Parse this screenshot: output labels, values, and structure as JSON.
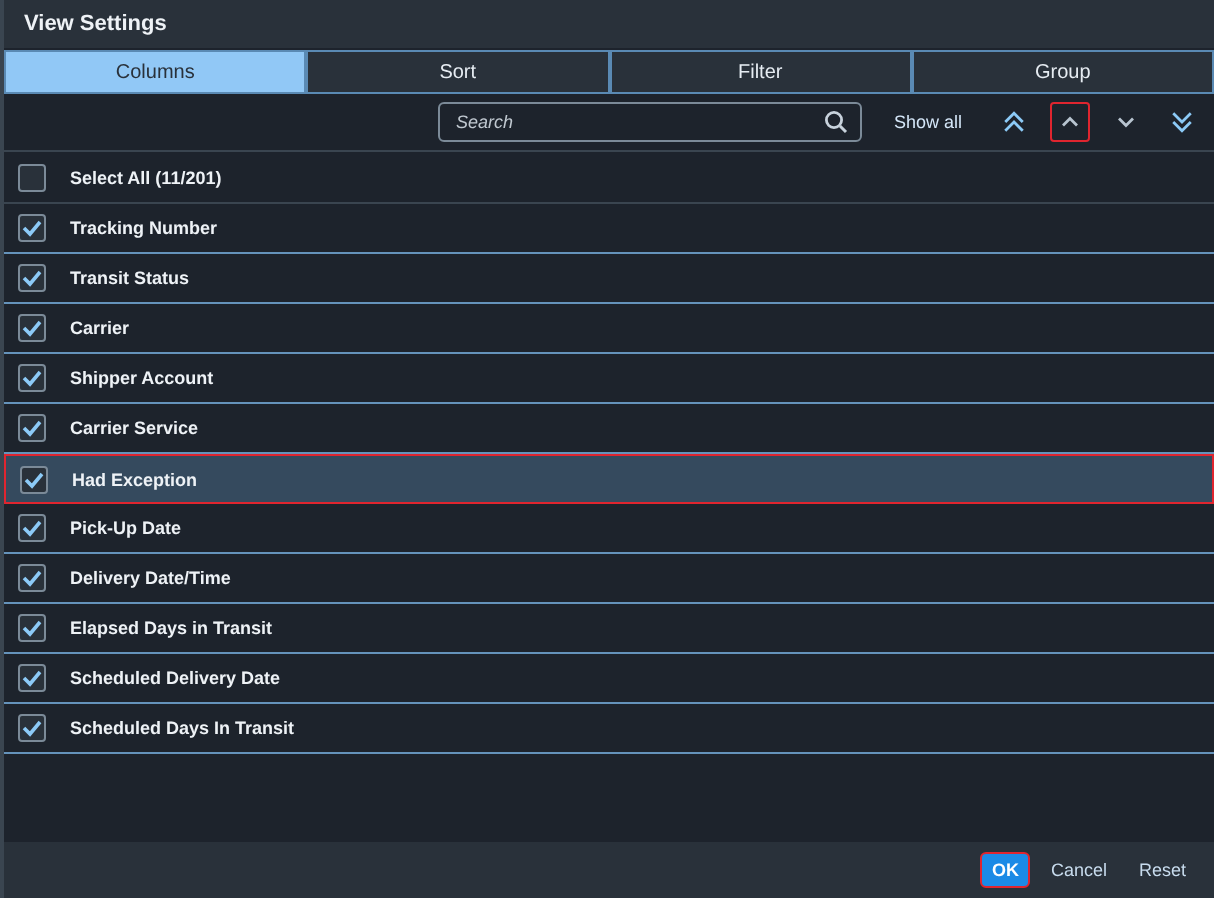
{
  "window": {
    "title": "View Settings"
  },
  "tabs": [
    {
      "label": "Columns",
      "selected": true
    },
    {
      "label": "Sort",
      "selected": false
    },
    {
      "label": "Filter",
      "selected": false
    },
    {
      "label": "Group",
      "selected": false
    }
  ],
  "toolbar": {
    "search": {
      "placeholder": "Search"
    },
    "show_all": "Show all",
    "move_buttons": [
      {
        "kind": "top",
        "highlighted": false
      },
      {
        "kind": "up",
        "highlighted": true
      },
      {
        "kind": "down",
        "highlighted": false
      },
      {
        "kind": "bottom",
        "highlighted": false
      }
    ]
  },
  "select_all": {
    "label": "Select All (11/201)",
    "checked": false
  },
  "columns": [
    {
      "label": "Tracking Number",
      "checked": true,
      "selected": false
    },
    {
      "label": "Transit Status",
      "checked": true,
      "selected": false
    },
    {
      "label": "Carrier",
      "checked": true,
      "selected": false
    },
    {
      "label": "Shipper Account",
      "checked": true,
      "selected": false
    },
    {
      "label": "Carrier Service",
      "checked": true,
      "selected": false
    },
    {
      "label": "Had Exception",
      "checked": true,
      "selected": true
    },
    {
      "label": "Pick-Up Date",
      "checked": true,
      "selected": false
    },
    {
      "label": "Delivery Date/Time",
      "checked": true,
      "selected": false
    },
    {
      "label": "Elapsed Days in Transit",
      "checked": true,
      "selected": false
    },
    {
      "label": "Scheduled Delivery Date",
      "checked": true,
      "selected": false
    },
    {
      "label": "Scheduled Days In Transit",
      "checked": true,
      "selected": false
    }
  ],
  "footer": {
    "buttons": [
      {
        "label": "OK",
        "kind": "primary",
        "highlighted": true
      },
      {
        "label": "Cancel",
        "kind": "plain",
        "highlighted": false
      },
      {
        "label": "Reset",
        "kind": "plain",
        "highlighted": false
      }
    ]
  }
}
